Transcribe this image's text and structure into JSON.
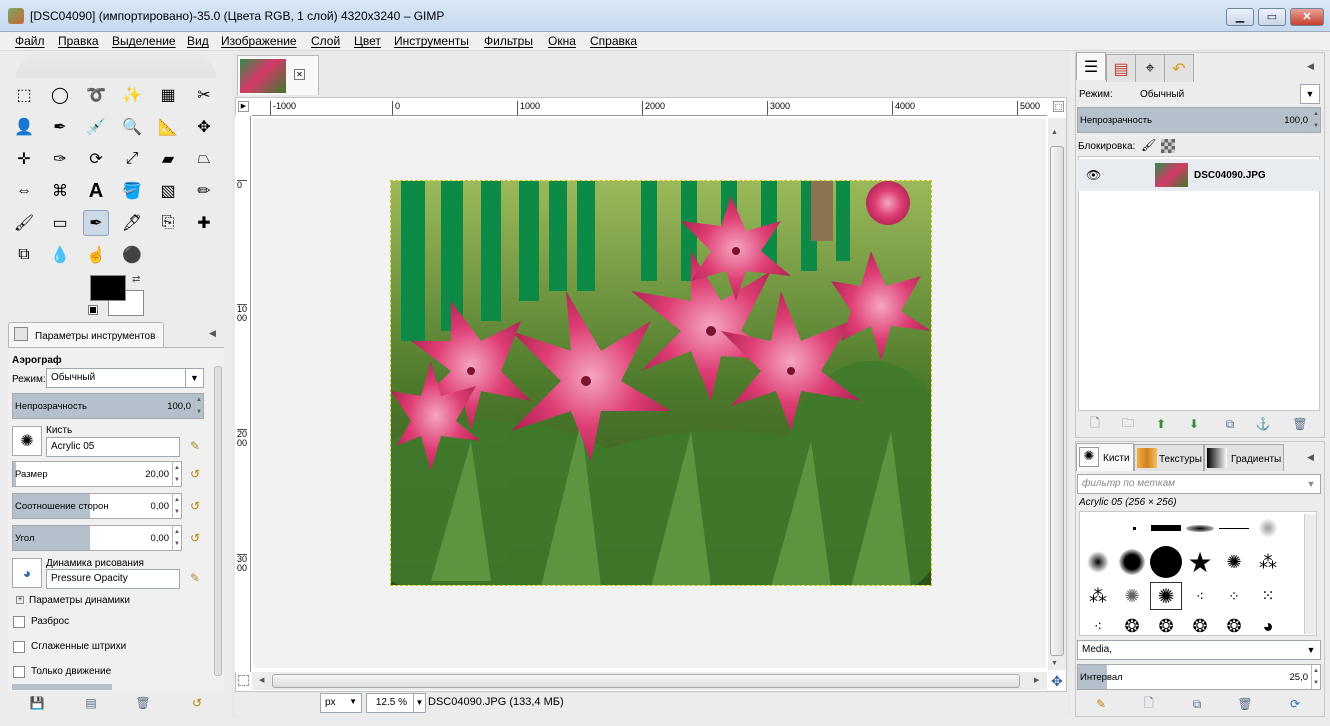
{
  "window": {
    "title": "[DSC04090] (импортировано)-35.0 (Цвета RGB, 1 слой) 4320x3240 – GIMP",
    "minimize": "▁",
    "maximize": "▭",
    "close": "✕"
  },
  "menu": [
    "Файл",
    "Правка",
    "Выделение",
    "Вид",
    "Изображение",
    "Слой",
    "Цвет",
    "Инструменты",
    "Фильтры",
    "Окна",
    "Справка"
  ],
  "toolbox": {
    "tools": [
      {
        "name": "rect-select-icon",
        "glyph": "⬚"
      },
      {
        "name": "ellipse-select-icon",
        "glyph": "◯"
      },
      {
        "name": "free-select-icon",
        "glyph": "➰"
      },
      {
        "name": "fuzzy-select-icon",
        "glyph": "✨"
      },
      {
        "name": "color-select-icon",
        "glyph": "▦"
      },
      {
        "name": "scissors-icon",
        "glyph": "✂"
      },
      {
        "name": "foreground-select-icon",
        "glyph": "👤"
      },
      {
        "name": "paths-icon",
        "glyph": "✒"
      },
      {
        "name": "color-picker-icon",
        "glyph": "💉"
      },
      {
        "name": "zoom-icon",
        "glyph": "🔍"
      },
      {
        "name": "measure-icon",
        "glyph": "📐"
      },
      {
        "name": "move-icon",
        "glyph": "✥"
      },
      {
        "name": "align-icon",
        "glyph": "✛"
      },
      {
        "name": "crop-icon",
        "glyph": "✑"
      },
      {
        "name": "rotate-icon",
        "glyph": "⟳"
      },
      {
        "name": "scale-icon",
        "glyph": "⤢"
      },
      {
        "name": "shear-icon",
        "glyph": "▰"
      },
      {
        "name": "perspective-icon",
        "glyph": "⏢"
      },
      {
        "name": "flip-icon",
        "glyph": "⇔"
      },
      {
        "name": "cage-icon",
        "glyph": "⌘"
      },
      {
        "name": "text-icon",
        "glyph": "A"
      },
      {
        "name": "bucket-fill-icon",
        "glyph": "🪣"
      },
      {
        "name": "gradient-icon",
        "glyph": "▧"
      },
      {
        "name": "pencil-icon",
        "glyph": "✏"
      },
      {
        "name": "paintbrush-icon",
        "glyph": "🖌"
      },
      {
        "name": "eraser-icon",
        "glyph": "▭"
      },
      {
        "name": "airbrush-icon",
        "glyph": "✒"
      },
      {
        "name": "ink-icon",
        "glyph": "🖋"
      },
      {
        "name": "clone-icon",
        "glyph": "⎘"
      },
      {
        "name": "heal-icon",
        "glyph": "✚"
      },
      {
        "name": "perspective-clone-icon",
        "glyph": "⧉"
      },
      {
        "name": "blur-icon",
        "glyph": "💧"
      },
      {
        "name": "smudge-icon",
        "glyph": "☝"
      },
      {
        "name": "dodge-burn-icon",
        "glyph": "⚫"
      }
    ]
  },
  "tool_options": {
    "tab_label": "Параметры инструментов",
    "tool_name": "Аэрограф",
    "mode_label": "Режим:",
    "mode_value": "Обычный",
    "opacity_label": "Непрозрачность",
    "opacity_value": "100,0",
    "brush_label": "Кисть",
    "brush_value": "Acrylic 05",
    "size_label": "Размер",
    "size_value": "20,00",
    "aspect_label": "Соотношение сторон",
    "aspect_value": "0,00",
    "angle_label": "Угол",
    "angle_value": "0,00",
    "dynamics_label": "Динамика рисования",
    "dynamics_value": "Pressure Opacity",
    "dynamics_params": "Параметры динамики",
    "scatter": "Разброс",
    "smooth": "Сглаженные штрихи",
    "motion_only": "Только движение"
  },
  "rulers": {
    "h": [
      "-1000",
      "0",
      "1000",
      "2000",
      "3000",
      "4000",
      "5000"
    ],
    "v": [
      "0",
      "1000",
      "2000",
      "3000"
    ]
  },
  "status": {
    "unit": "px",
    "zoom": "12.5 %",
    "info": "DSC04090.JPG (133,4 МБ)"
  },
  "layers": {
    "mode_label": "Режим:",
    "mode_value": "Обычный",
    "opacity_label": "Непрозрачность",
    "opacity_value": "100,0",
    "lock_label": "Блокировка:",
    "layer_name": "DSC04090.JPG"
  },
  "brushes": {
    "tab_brushes": "Кисти",
    "tab_patterns": "Текстуры",
    "tab_gradients": "Градиенты",
    "filter_placeholder": "фильтр по меткам",
    "selected_brush": "Acrylic 05 (256 × 256)",
    "tag_value": "Media,",
    "spacing_label": "Интервал",
    "spacing_value": "25,0"
  }
}
